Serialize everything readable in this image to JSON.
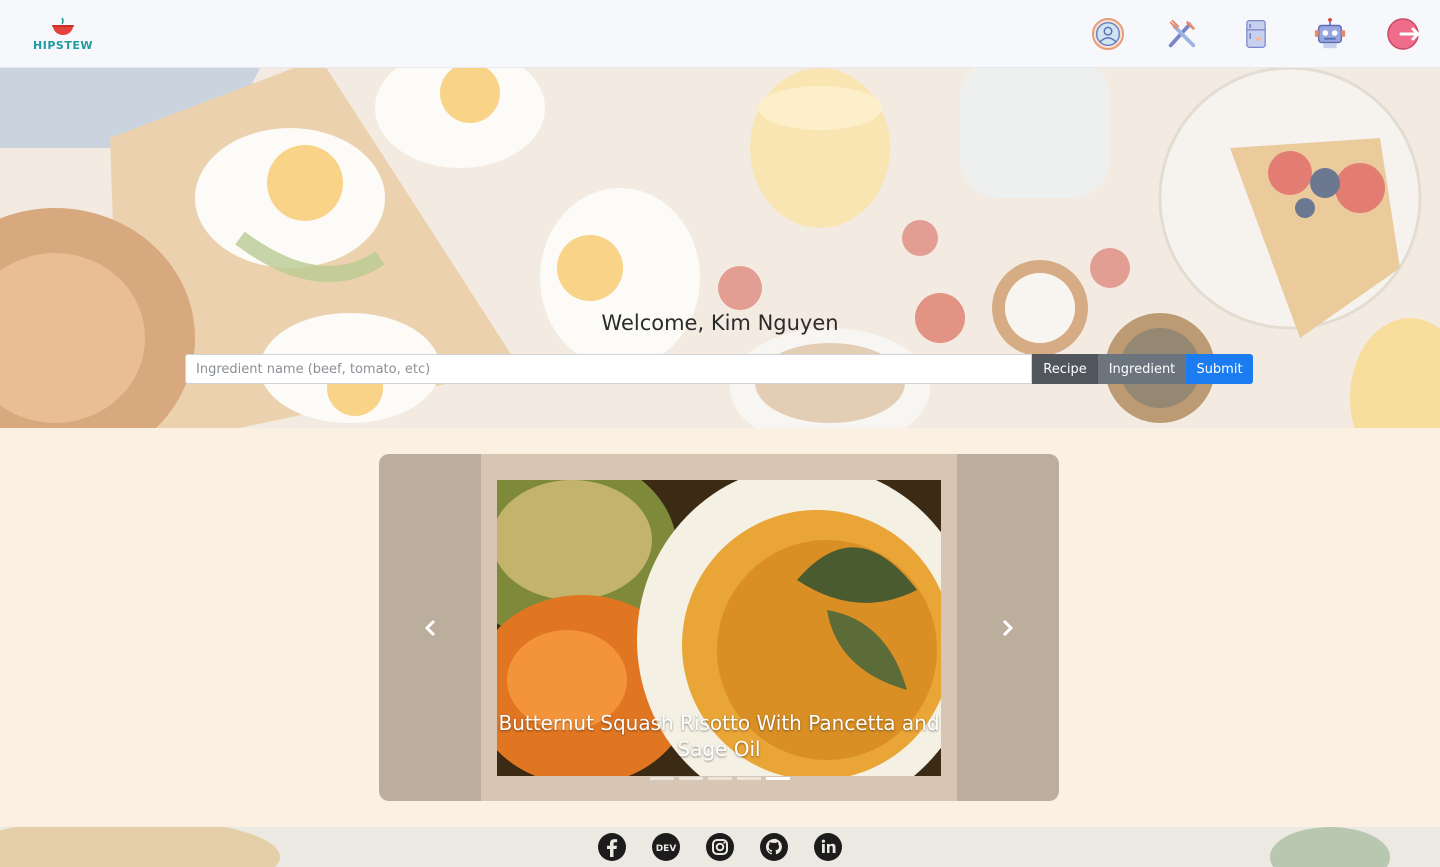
{
  "brand": {
    "name": "HIPSTEW",
    "logo_icon": "soup-bowl-icon"
  },
  "nav": {
    "items": [
      {
        "name": "profile",
        "icon": "user-profile-icon"
      },
      {
        "name": "recipes",
        "icon": "fork-knife-icon"
      },
      {
        "name": "fridge",
        "icon": "fridge-icon"
      },
      {
        "name": "robot",
        "icon": "robot-icon"
      },
      {
        "name": "logout",
        "icon": "logout-icon"
      }
    ]
  },
  "hero": {
    "welcome": "Welcome, Kim Nguyen",
    "search": {
      "placeholder": "Ingredient name (beef, tomato, etc)",
      "value": ""
    },
    "buttons": {
      "recipe": "Recipe",
      "ingredient": "Ingredient",
      "submit": "Submit"
    }
  },
  "carousel": {
    "caption": "Butternut Squash Risotto With Pancetta and Sage Oil",
    "indicator_count": 5,
    "active_index": 4
  },
  "footer": {
    "social": [
      "facebook-icon",
      "dev-icon",
      "instagram-icon",
      "github-icon",
      "linkedin-icon"
    ]
  },
  "colors": {
    "brand": "#1f9a9f",
    "submit": "#1a7cf0",
    "recipe_btn": "#50565c",
    "ingredient_btn": "#6c757d",
    "page_bg": "#fbf0e2",
    "carousel_ctrl": "#bcae9c"
  }
}
